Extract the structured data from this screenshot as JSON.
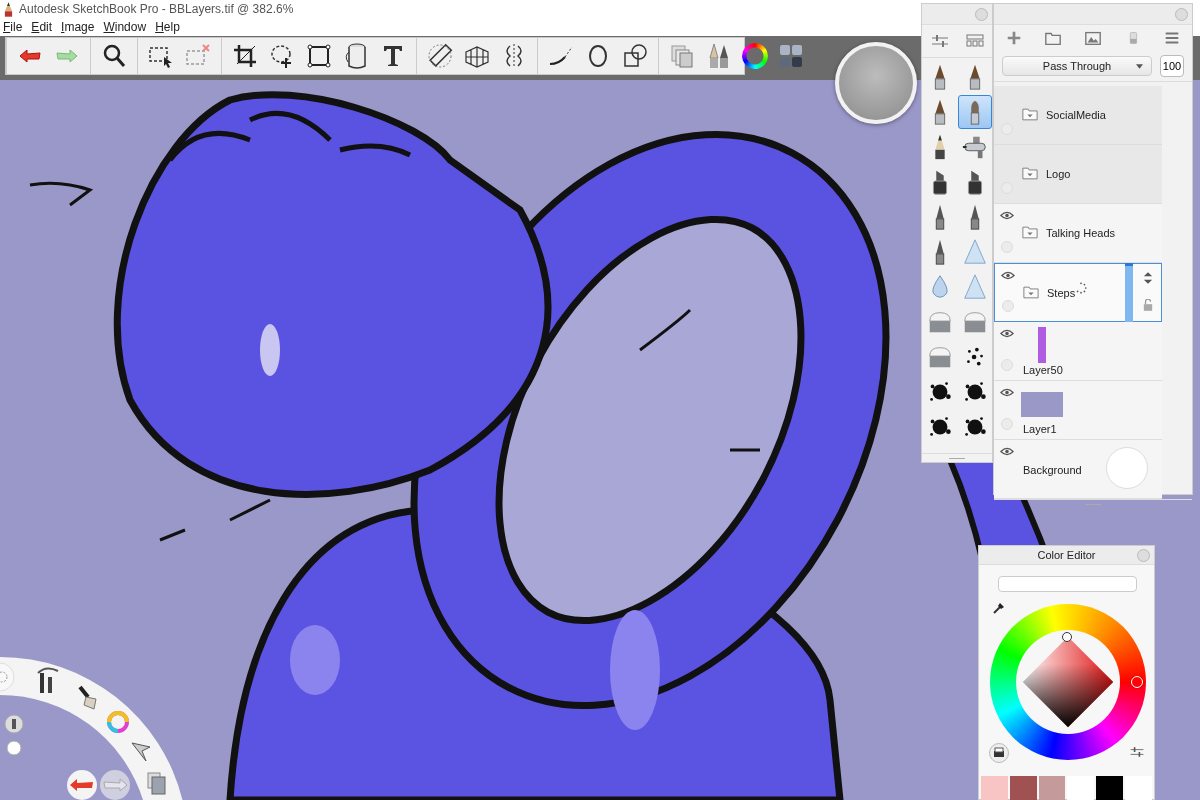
{
  "window": {
    "title": "Autodesk SketchBook Pro - BBLayers.tif @ 382.6%"
  },
  "menu": [
    "File",
    "Edit",
    "Image",
    "Window",
    "Help"
  ],
  "brushes": [
    {
      "kind": "nib",
      "selected": false
    },
    {
      "kind": "nib",
      "selected": false
    },
    {
      "kind": "nib",
      "selected": false
    },
    {
      "kind": "paintbrush",
      "selected": true
    },
    {
      "kind": "pencil",
      "selected": false
    },
    {
      "kind": "airbrush",
      "selected": false
    },
    {
      "kind": "marker",
      "selected": false
    },
    {
      "kind": "marker",
      "selected": false
    },
    {
      "kind": "pen",
      "selected": false
    },
    {
      "kind": "pen",
      "selected": false
    },
    {
      "kind": "pen",
      "selected": false
    },
    {
      "kind": "cone",
      "selected": false
    },
    {
      "kind": "drop",
      "selected": false
    },
    {
      "kind": "cone",
      "selected": false
    },
    {
      "kind": "eraser",
      "selected": false
    },
    {
      "kind": "eraser",
      "selected": false
    },
    {
      "kind": "eraser",
      "selected": false
    },
    {
      "kind": "speckle",
      "selected": false
    },
    {
      "kind": "splatter",
      "selected": false
    },
    {
      "kind": "splatter",
      "selected": false
    },
    {
      "kind": "splatter",
      "selected": false
    },
    {
      "kind": "splatter",
      "selected": false
    }
  ],
  "layers_panel": {
    "blend_mode": "Pass Through",
    "opacity": "100",
    "layers": [
      {
        "name": "SocialMedia",
        "kind": "group",
        "visible": false,
        "selected": false,
        "busy": false
      },
      {
        "name": "Logo",
        "kind": "group",
        "visible": false,
        "selected": false,
        "busy": false
      },
      {
        "name": "Talking Heads",
        "kind": "group",
        "visible": true,
        "selected": false,
        "busy": false
      },
      {
        "name": "Steps",
        "kind": "group",
        "visible": true,
        "selected": true,
        "busy": true
      },
      {
        "name": "Layer50",
        "kind": "strokes",
        "color": "#b05ce0",
        "visible": true,
        "selected": false,
        "busy": false
      },
      {
        "name": "Layer1",
        "kind": "fill",
        "color": "#9a98c6",
        "visible": true,
        "selected": false,
        "busy": false
      },
      {
        "name": "Background",
        "kind": "background",
        "color": "#ffffff",
        "visible": true,
        "selected": false,
        "busy": false
      }
    ]
  },
  "color_editor": {
    "title": "Color Editor",
    "swatches": [
      {
        "color": "#f9c4c4"
      },
      {
        "color": "#a05252"
      },
      {
        "color": "#c49a9a"
      },
      {
        "color": "#ffffff"
      },
      {
        "color": "#000000"
      },
      {
        "color": "#ffffff"
      }
    ]
  }
}
